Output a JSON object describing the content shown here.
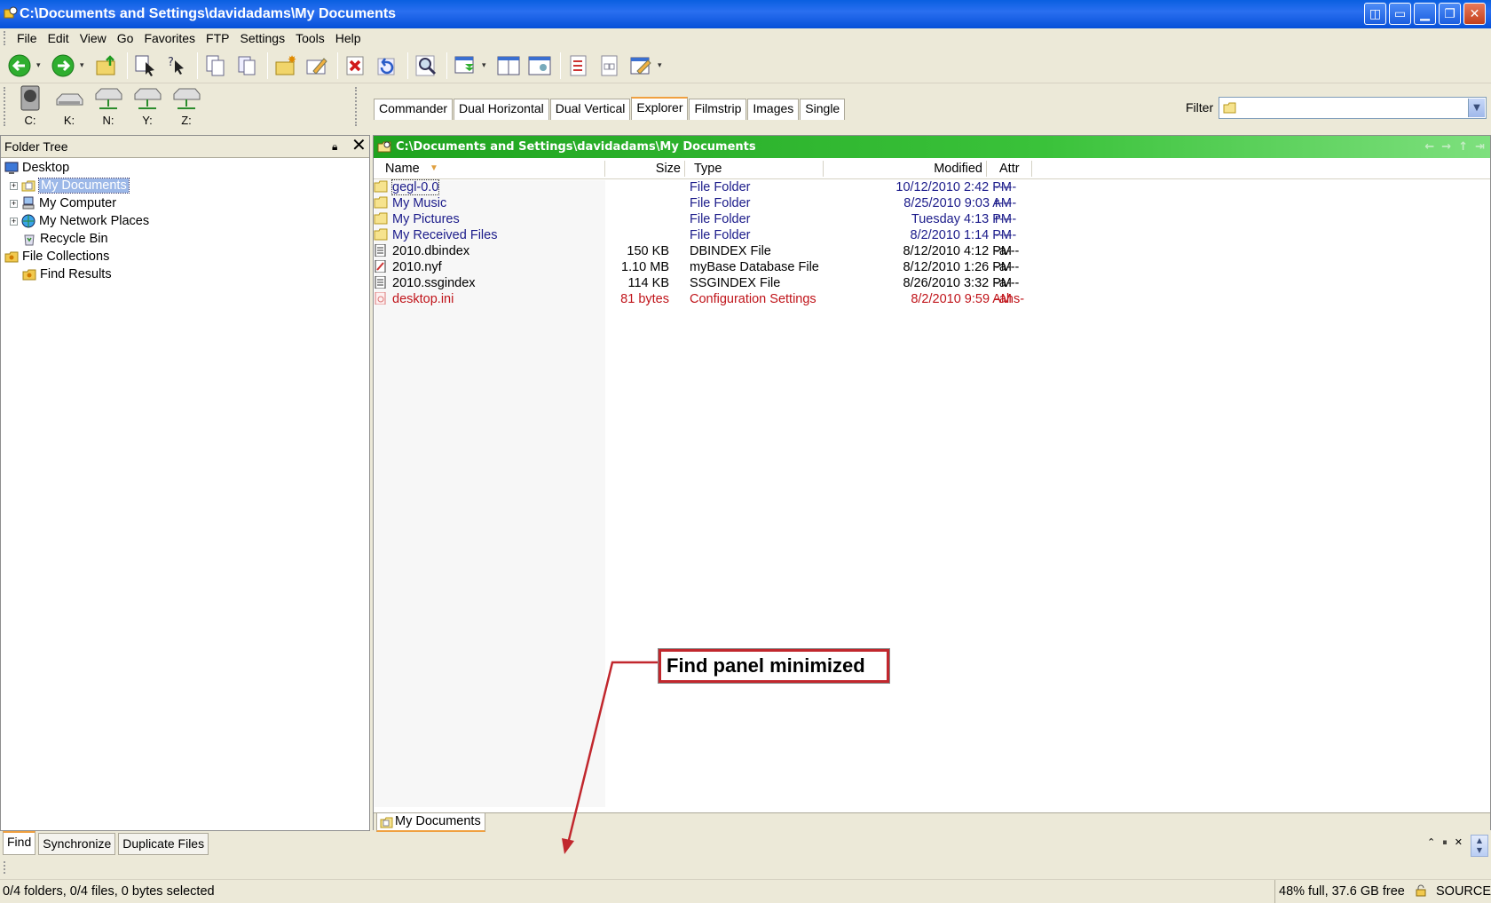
{
  "window": {
    "title": "C:\\Documents and Settings\\davidadams\\My Documents"
  },
  "menu": [
    "File",
    "Edit",
    "View",
    "Go",
    "Favorites",
    "FTP",
    "Settings",
    "Tools",
    "Help"
  ],
  "drives": [
    {
      "label": "C:",
      "icon": "local-disk-icon"
    },
    {
      "label": "K:",
      "icon": "removable-drive-icon"
    },
    {
      "label": "N:",
      "icon": "network-drive-icon"
    },
    {
      "label": "Y:",
      "icon": "network-drive-icon"
    },
    {
      "label": "Z:",
      "icon": "network-drive-icon"
    }
  ],
  "layout_tabs": [
    "Commander",
    "Dual Horizontal",
    "Dual Vertical",
    "Explorer",
    "Filmstrip",
    "Images",
    "Single"
  ],
  "layout_active": "Explorer",
  "filter": {
    "label": "Filter",
    "value": ""
  },
  "tree": {
    "title": "Folder Tree",
    "nodes": [
      "Desktop",
      "My Documents",
      "My Computer",
      "My Network Places",
      "Recycle Bin",
      "File Collections",
      "Find Results"
    ]
  },
  "main": {
    "path": "C:\\Documents and Settings\\davidadams\\My Documents",
    "columns": {
      "name": "Name",
      "size": "Size",
      "type": "Type",
      "modified": "Modified",
      "attr": "Attr"
    },
    "files": [
      {
        "name": "gegl-0.0",
        "size": "",
        "type": "File Folder",
        "modified": "10/12/2010 2:42 PM",
        "attr": "-----"
      },
      {
        "name": "My Music",
        "size": "",
        "type": "File Folder",
        "modified": "8/25/2010 9:03 AM",
        "attr": "r----"
      },
      {
        "name": "My Pictures",
        "size": "",
        "type": "File Folder",
        "modified": "Tuesday 4:13 PM",
        "attr": "r----"
      },
      {
        "name": "My Received Files",
        "size": "",
        "type": "File Folder",
        "modified": "8/2/2010 1:14 PM",
        "attr": "-----"
      },
      {
        "name": "2010.dbindex",
        "size": "150 KB",
        "type": "DBINDEX File",
        "modified": "8/12/2010 4:12 PM",
        "attr": "-a---"
      },
      {
        "name": "2010.nyf",
        "size": "1.10 MB",
        "type": "myBase Database File",
        "modified": "8/12/2010 1:26 PM",
        "attr": "-a---"
      },
      {
        "name": "2010.ssgindex",
        "size": "114 KB",
        "type": "SSGINDEX File",
        "modified": "8/26/2010 3:32 PM",
        "attr": "-a---"
      },
      {
        "name": "desktop.ini",
        "size": "81 bytes",
        "type": "Configuration Settings",
        "modified": "8/2/2010 9:59 AM",
        "attr": "-ahs-"
      }
    ],
    "bottom_tab": "My Documents"
  },
  "find_panel": {
    "tabs": [
      "Find",
      "Synchronize",
      "Duplicate Files"
    ]
  },
  "status": {
    "selection": "0/4 folders, 0/4 files, 0 bytes selected",
    "disk": "48% full, 37.6 GB free",
    "pane": "SOURCE"
  },
  "annotation": {
    "text": "Find panel minimized"
  },
  "colors": {
    "accent_green": "#2fb52f",
    "titlebar_blue": "#0a5fe0",
    "annotation_red": "#c1272d",
    "folder_text": "#1b1b8a",
    "hidden_file_text": "#c0141a"
  }
}
